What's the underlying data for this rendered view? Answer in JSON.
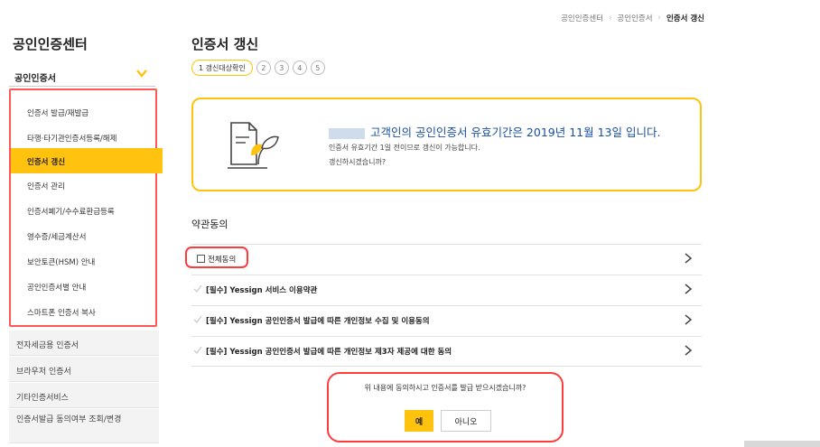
{
  "breadcrumb": {
    "items": [
      "공인인증센터",
      "공인인증서"
    ],
    "current": "인증서 갱신"
  },
  "sidebar": {
    "title": "공인인증센터",
    "section_label": "공인인증서",
    "items": [
      {
        "label": "인증서 발급/재발급"
      },
      {
        "label": "타행·타기관인증서등록/해제"
      },
      {
        "label": "인증서 갱신"
      },
      {
        "label": "인증서 관리"
      },
      {
        "label": "인증서폐기/수수료환급등록"
      },
      {
        "label": "영수증/세금계산서"
      },
      {
        "label": "보안토큰(HSM) 안내"
      },
      {
        "label": "공인인증서별 안내"
      },
      {
        "label": "스마트폰 인증서 복사"
      }
    ],
    "active_index": 2,
    "lower_items": [
      {
        "label": "전자세금용 인증서"
      },
      {
        "label": "브라우저 인증서"
      },
      {
        "label": "기타인증서비스"
      },
      {
        "label": "인증서발급 동의여부 조회/변경"
      }
    ]
  },
  "main": {
    "title": "인증서 갱신",
    "steps": {
      "active_label": "1 갱신대상확인",
      "others": [
        "2",
        "3",
        "4",
        "5"
      ]
    },
    "notice": {
      "line1": "고객인의 공인인증서 유효기간은 2019년 11월 13일 입니다.",
      "line2": "인증서 유효기간 1일 전이므로 갱신이 가능합니다.",
      "line3": "갱신하시겠습니까?"
    },
    "terms_title": "약관동의",
    "all_agree_label": "전체동의",
    "terms": [
      {
        "label": "[필수] Yessign 서비스 이용약관"
      },
      {
        "label": "[필수] Yessign 공인인증서 발급에 따른 개인정보 수집 및 이용동의"
      },
      {
        "label": "[필수] Yessign 공인인증서 발급에 따른 개인정보 제3자 제공에 대한 동의"
      }
    ],
    "confirm": {
      "question": "위 내용에 동의하시고 인증서를 발급 받으시겠습니까?",
      "yes_label": "예",
      "no_label": "아니오"
    }
  },
  "colors": {
    "accent": "#ffc20e",
    "highlight_red": "#ff3b3b",
    "notice_blue": "#1a4fa0"
  }
}
